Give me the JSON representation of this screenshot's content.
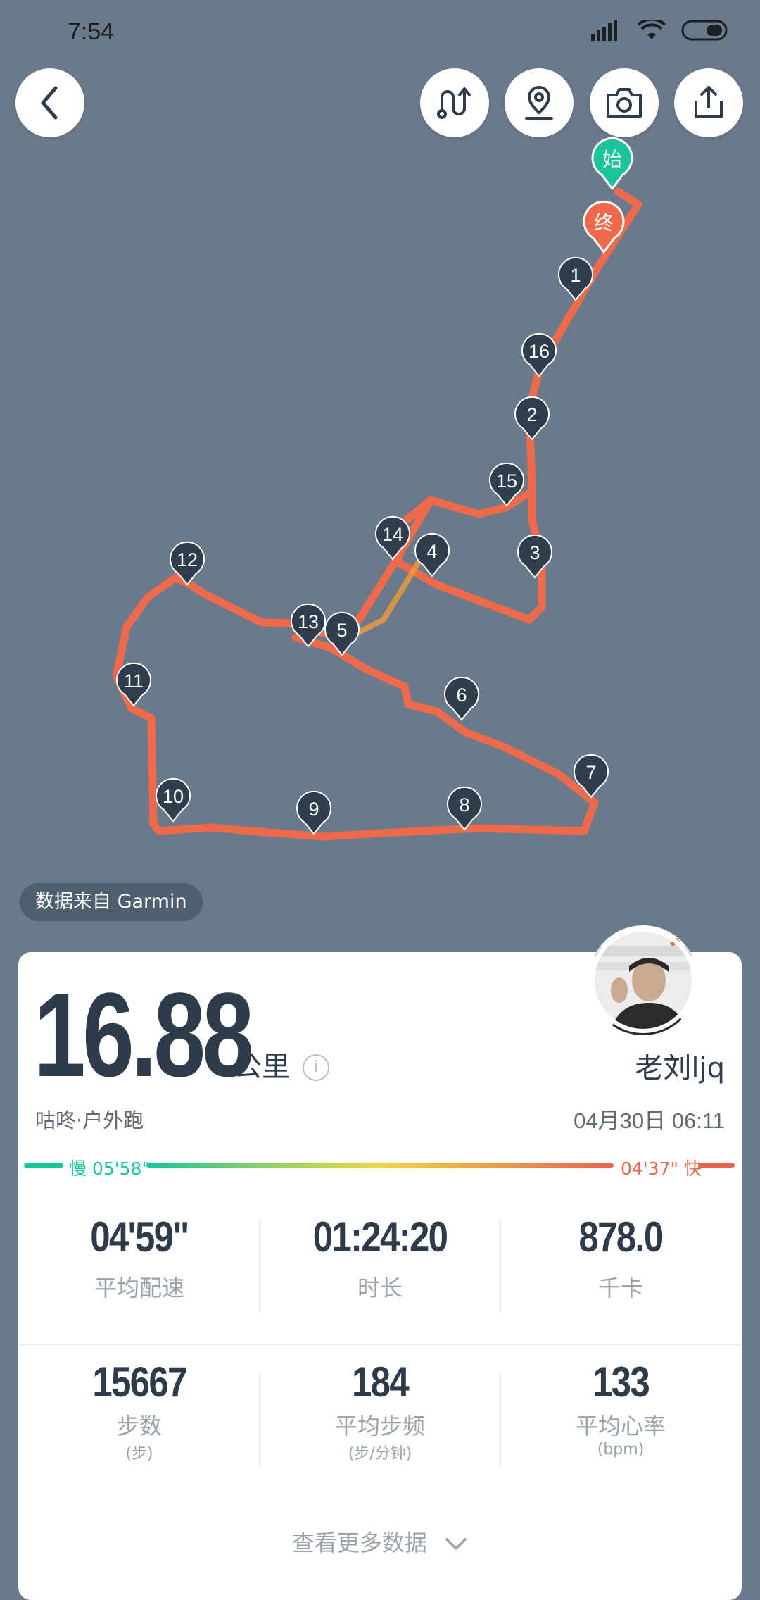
{
  "status_bar": {
    "time": "7:54"
  },
  "toolbar": {
    "back_icon": "chevron-left-icon",
    "route_icon": "route-icon",
    "location_icon": "map-pin-icon",
    "camera_icon": "camera-icon",
    "share_icon": "share-icon"
  },
  "map": {
    "start_label": "始",
    "end_label": "终",
    "markers": [
      "1",
      "2",
      "3",
      "4",
      "5",
      "6",
      "7",
      "8",
      "9",
      "10",
      "11",
      "12",
      "13",
      "14",
      "15",
      "16"
    ],
    "route_color": "#ef6a4a",
    "start_color": "#1cc49a",
    "end_color": "#ef6a4a",
    "marker_color": "#2f3d4d"
  },
  "source": {
    "text": "数据来自 Garmin"
  },
  "summary": {
    "distance": "16.88",
    "unit": "公里",
    "username": "老刘ljq",
    "activity": "咕咚·户外跑",
    "datetime": "04月30日 06:11",
    "pace_slow": "慢 05'58\"",
    "pace_fast": "04'37\" 快"
  },
  "stats": [
    {
      "value": "04'59\"",
      "label": "平均配速",
      "sub": ""
    },
    {
      "value": "01:24:20",
      "label": "时长",
      "sub": ""
    },
    {
      "value": "878.0",
      "label": "千卡",
      "sub": ""
    },
    {
      "value": "15667",
      "label": "步数",
      "sub": "(步)"
    },
    {
      "value": "184",
      "label": "平均步频",
      "sub": "(步/分钟)"
    },
    {
      "value": "133",
      "label": "平均心率",
      "sub": "(bpm)"
    }
  ],
  "more": {
    "label": "查看更多数据"
  },
  "colors": {
    "background": "#6b7a8b",
    "text_dark": "#2e3b4a",
    "slow": "#19c59b",
    "fast": "#e6674b"
  }
}
